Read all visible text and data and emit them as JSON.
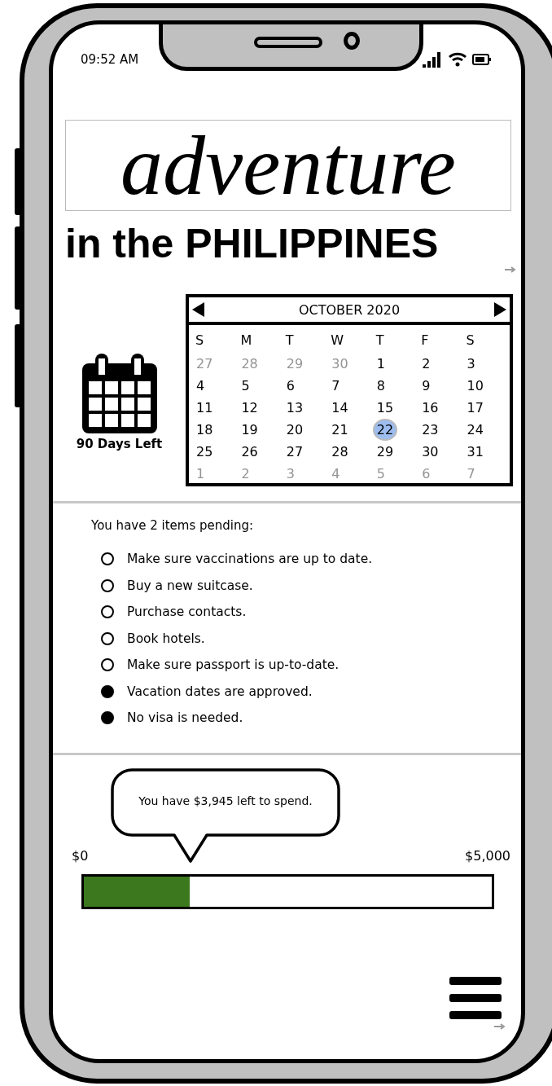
{
  "status_bar": {
    "time": "09:52 AM"
  },
  "title": {
    "script": "adventure",
    "subtitle": "in the PHILIPPINES"
  },
  "countdown": {
    "label": "90 Days Left"
  },
  "calendar": {
    "month": "OCTOBER 2020",
    "weekdays": [
      "S",
      "M",
      "T",
      "W",
      "T",
      "F",
      "S"
    ],
    "weeks": [
      [
        {
          "day": "27",
          "muted": true,
          "selected": false
        },
        {
          "day": "28",
          "muted": true,
          "selected": false
        },
        {
          "day": "29",
          "muted": true,
          "selected": false
        },
        {
          "day": "30",
          "muted": true,
          "selected": false
        },
        {
          "day": "1",
          "muted": false,
          "selected": false
        },
        {
          "day": "2",
          "muted": false,
          "selected": false
        },
        {
          "day": "3",
          "muted": false,
          "selected": false
        }
      ],
      [
        {
          "day": "4",
          "muted": false,
          "selected": false
        },
        {
          "day": "5",
          "muted": false,
          "selected": false
        },
        {
          "day": "6",
          "muted": false,
          "selected": false
        },
        {
          "day": "7",
          "muted": false,
          "selected": false
        },
        {
          "day": "8",
          "muted": false,
          "selected": false
        },
        {
          "day": "9",
          "muted": false,
          "selected": false
        },
        {
          "day": "10",
          "muted": false,
          "selected": false
        }
      ],
      [
        {
          "day": "11",
          "muted": false,
          "selected": false
        },
        {
          "day": "12",
          "muted": false,
          "selected": false
        },
        {
          "day": "13",
          "muted": false,
          "selected": false
        },
        {
          "day": "14",
          "muted": false,
          "selected": false
        },
        {
          "day": "15",
          "muted": false,
          "selected": false
        },
        {
          "day": "16",
          "muted": false,
          "selected": false
        },
        {
          "day": "17",
          "muted": false,
          "selected": false
        }
      ],
      [
        {
          "day": "18",
          "muted": false,
          "selected": false
        },
        {
          "day": "19",
          "muted": false,
          "selected": false
        },
        {
          "day": "20",
          "muted": false,
          "selected": false
        },
        {
          "day": "21",
          "muted": false,
          "selected": false
        },
        {
          "day": "22",
          "muted": false,
          "selected": true
        },
        {
          "day": "23",
          "muted": false,
          "selected": false
        },
        {
          "day": "24",
          "muted": false,
          "selected": false
        }
      ],
      [
        {
          "day": "25",
          "muted": false,
          "selected": false
        },
        {
          "day": "26",
          "muted": false,
          "selected": false
        },
        {
          "day": "27",
          "muted": false,
          "selected": false
        },
        {
          "day": "28",
          "muted": false,
          "selected": false
        },
        {
          "day": "29",
          "muted": false,
          "selected": false
        },
        {
          "day": "30",
          "muted": false,
          "selected": false
        },
        {
          "day": "31",
          "muted": false,
          "selected": false
        }
      ],
      [
        {
          "day": "1",
          "muted": true,
          "selected": false
        },
        {
          "day": "2",
          "muted": true,
          "selected": false
        },
        {
          "day": "3",
          "muted": true,
          "selected": false
        },
        {
          "day": "4",
          "muted": true,
          "selected": false
        },
        {
          "day": "5",
          "muted": true,
          "selected": false
        },
        {
          "day": "6",
          "muted": true,
          "selected": false
        },
        {
          "day": "7",
          "muted": true,
          "selected": false
        }
      ]
    ]
  },
  "checklist": {
    "heading": "You have 2 items pending:",
    "items": [
      {
        "text": "Make sure vaccinations are up to date.",
        "checked": false
      },
      {
        "text": "Buy a new suitcase.",
        "checked": false
      },
      {
        "text": "Purchase contacts.",
        "checked": false
      },
      {
        "text": "Book hotels.",
        "checked": false
      },
      {
        "text": "Make sure passport is up-to-date.",
        "checked": false
      },
      {
        "text": "Vacation dates are approved.",
        "checked": true
      },
      {
        "text": "No visa is needed.",
        "checked": true
      }
    ]
  },
  "budget": {
    "tooltip": "You have $3,945 left to spend.",
    "min_label": "$0",
    "max_label": "$5,000",
    "level": 0.26
  }
}
